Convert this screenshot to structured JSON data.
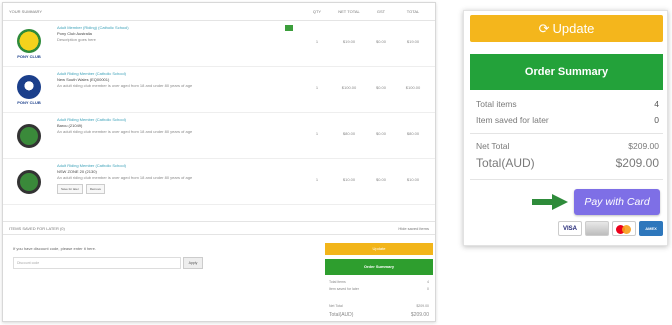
{
  "left_panel": {
    "header": {
      "title": "YOUR SUMMARY",
      "cols": [
        "QTY",
        "NET TOTAL",
        "GST",
        "TOTAL"
      ]
    },
    "items": [
      {
        "title": "Adult Member (Riding) (Catholic School)",
        "subtitle": "Pony Club Australia",
        "detail": "Description goes here",
        "logo_text": "PONY CLUB",
        "qty": "1",
        "net": "$19.00",
        "gst": "$0.00",
        "total": "$19.00"
      },
      {
        "title": "Adult Riding Member (Catholic School)",
        "subtitle": "New South Wales (EQ00001)",
        "detail": "An adult riding club member is over aged from 18 and under 80 years of age",
        "logo_text": "PONY CLUB",
        "qty": "1",
        "net": "$100.00",
        "gst": "$0.00",
        "total": "$100.00"
      },
      {
        "title": "Adult Riding Member (Catholic School)",
        "subtitle": "Barcu (21049)",
        "detail": "An adult riding club member is over aged from 18 and under 80 years of age",
        "qty": "1",
        "net": "$80.00",
        "gst": "$0.00",
        "total": "$80.00"
      },
      {
        "title": "Adult Riding Member (Catholic School)",
        "subtitle": "NSW ZONE 20 (2130)",
        "detail": "An adult riding club member is over aged from 18 and under 80 years of age",
        "qty": "1",
        "net": "$10.00",
        "gst": "$0.00",
        "total": "$10.00",
        "save_label": "Save for later",
        "remove_label": "Remove"
      }
    ],
    "promo": {
      "left": "ITEMS SAVED FOR LATER (0)",
      "right": "Hide saved items"
    },
    "discount": {
      "label": "If you have discount code, please enter it here.",
      "placeholder": "Discount code",
      "apply": "Apply"
    },
    "mini_summary": {
      "update": "Update",
      "title": "Order Summary",
      "total_items_label": "Total items",
      "total_items": "4",
      "saved_label": "Item saved for later",
      "saved": "0",
      "net_label": "Net Total",
      "net": "$209.00",
      "total_label": "Total(AUD)",
      "total": "$209.00"
    }
  },
  "right_panel": {
    "update_label": "Update",
    "update_icon": "refresh-icon",
    "summary_title": "Order Summary",
    "total_items_label": "Total items",
    "total_items_value": "4",
    "saved_label": "Item saved for later",
    "saved_value": "0",
    "net_total_label": "Net Total",
    "net_total_value": "$209.00",
    "total_label": "Total(AUD)",
    "total_value": "$209.00",
    "pay_label": "Pay with Card",
    "cards": [
      "VISA",
      "mastercard",
      "generic",
      "AMEX"
    ]
  },
  "colors": {
    "update": "#f4b61c",
    "summary": "#23a23a",
    "pay": "#7e6fe6",
    "arrow": "#2e8b3a"
  }
}
